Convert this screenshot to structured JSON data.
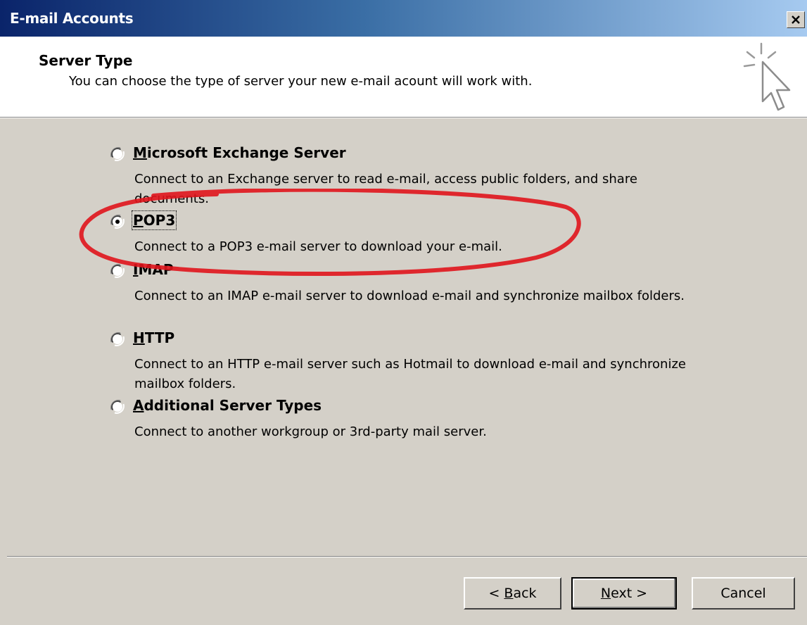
{
  "window": {
    "title": "E-mail Accounts"
  },
  "header": {
    "title": "Server Type",
    "subtitle": "You can choose the type of server your new e-mail acount will work with."
  },
  "options": [
    {
      "mnemonic": "M",
      "rest": "icrosoft Exchange Server",
      "desc": "Connect to an Exchange server to read e-mail, access public folders, and share documents.",
      "selected": false
    },
    {
      "mnemonic": "P",
      "rest": "OP3",
      "desc": "Connect to a POP3 e-mail server to download your e-mail.",
      "selected": true
    },
    {
      "mnemonic": "I",
      "rest": "MAP",
      "desc": "Connect to an IMAP e-mail server to download e-mail and synchronize mailbox folders.",
      "selected": false
    },
    {
      "mnemonic": "H",
      "rest": "TTP",
      "desc": "Connect to an HTTP e-mail server such as Hotmail to download e-mail and synchronize mailbox folders.",
      "selected": false
    },
    {
      "mnemonic": "A",
      "rest": "dditional Server Types",
      "desc": "Connect to another workgroup or 3rd-party mail server.",
      "selected": false
    }
  ],
  "buttons": {
    "back": {
      "prefix": "< ",
      "mnemonic": "B",
      "rest": "ack"
    },
    "next": {
      "mnemonic": "N",
      "rest": "ext >"
    },
    "cancel": "Cancel"
  },
  "icons": {
    "close": "close-icon",
    "wizard": "wizard-cursor-icon",
    "highlight": "red-ellipse-annotation"
  },
  "colors": {
    "dialog_bg": "#d4d0c8",
    "title_start": "#0a246a",
    "title_end": "#a6caf0",
    "annotation": "#e0141c"
  }
}
